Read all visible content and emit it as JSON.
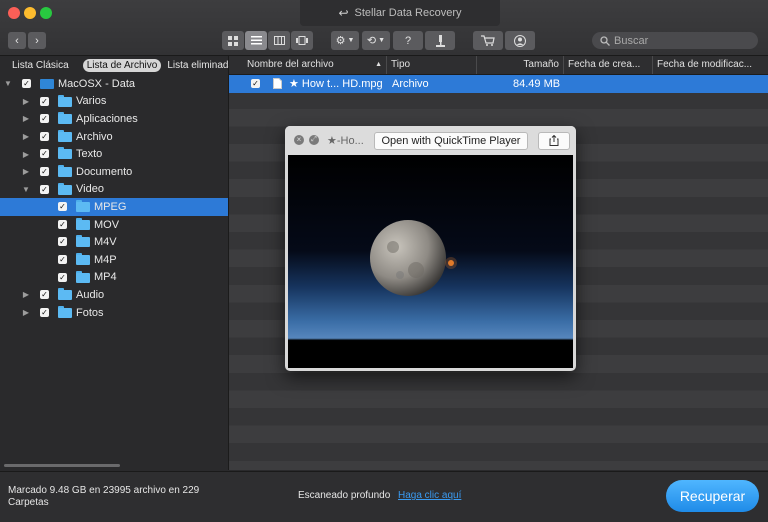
{
  "window": {
    "title": "Stellar Data Recovery"
  },
  "toolbar": {
    "nav_back": "‹",
    "nav_forward": "›",
    "help": "?",
    "search_placeholder": "Buscar"
  },
  "left_tabs": [
    "Lista Clásica",
    "Lista de Archivo",
    "Lista eliminada"
  ],
  "tree": [
    {
      "label": "MacOSX - Data",
      "level": 0,
      "expanded": true,
      "icon": "drive-icon",
      "selected": false
    },
    {
      "label": "Varios",
      "level": 1,
      "expanded": false,
      "icon": "folder-icon",
      "selected": false
    },
    {
      "label": "Aplicaciones",
      "level": 1,
      "expanded": false,
      "icon": "folder-icon",
      "selected": false
    },
    {
      "label": "Archivo",
      "level": 1,
      "expanded": false,
      "icon": "folder-icon",
      "selected": false
    },
    {
      "label": "Texto",
      "level": 1,
      "expanded": false,
      "icon": "folder-icon",
      "selected": false
    },
    {
      "label": "Documento",
      "level": 1,
      "expanded": false,
      "icon": "folder-icon",
      "selected": false
    },
    {
      "label": "Video",
      "level": 1,
      "expanded": true,
      "icon": "folder-icon",
      "selected": false
    },
    {
      "label": "MPEG",
      "level": 2,
      "expanded": null,
      "icon": "folder-icon",
      "selected": true
    },
    {
      "label": "MOV",
      "level": 2,
      "expanded": null,
      "icon": "folder-icon",
      "selected": false
    },
    {
      "label": "M4V",
      "level": 2,
      "expanded": null,
      "icon": "folder-icon",
      "selected": false
    },
    {
      "label": "M4P",
      "level": 2,
      "expanded": null,
      "icon": "folder-icon",
      "selected": false
    },
    {
      "label": "MP4",
      "level": 2,
      "expanded": null,
      "icon": "folder-icon",
      "selected": false
    },
    {
      "label": "Audio",
      "level": 1,
      "expanded": false,
      "icon": "folder-icon",
      "selected": false
    },
    {
      "label": "Fotos",
      "level": 1,
      "expanded": false,
      "icon": "folder-icon",
      "selected": false
    }
  ],
  "columns": [
    "Nombre del archivo",
    "Tipo",
    "Tamaño",
    "Fecha de crea...",
    "Fecha de modificac..."
  ],
  "file_row": {
    "name": "★ How t... HD.mpg",
    "type": "Archivo",
    "size": "84.49 MB"
  },
  "quicklook": {
    "title": "★-Ho...",
    "open_button": "Open with QuickTime Player"
  },
  "footer": {
    "status": "Marcado 9.48 GB en 23995 archivo en 229 Carpetas",
    "deep_scan_label": "Escaneado profundo",
    "deep_scan_link": "Haga clic aquí",
    "recover_button": "Recuperar"
  },
  "colors": {
    "selection": "#2d7ad7",
    "accent": "#1f8be8",
    "folder": "#5cbaf3"
  }
}
